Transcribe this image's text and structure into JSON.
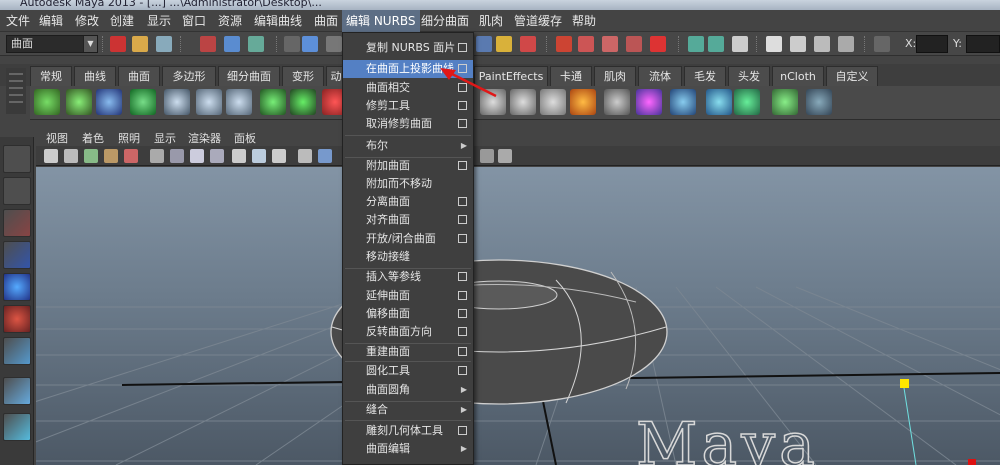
{
  "window_title": "Autodesk Maya 2013 - [...] ...\\Administrator\\Desktop\\...",
  "menubar": {
    "items": [
      "文件",
      "编辑",
      "修改",
      "创建",
      "显示",
      "窗口",
      "资源",
      "编辑曲线",
      "曲面",
      "编辑 NURBS",
      "细分曲面",
      "肌肉",
      "管道缓存",
      "帮助"
    ],
    "active": "编辑 NURBS"
  },
  "statusline": {
    "mode": "曲面",
    "x_label": "X:",
    "y_label": "Y:"
  },
  "shelf": {
    "tabs": [
      "常规",
      "曲线",
      "曲面",
      "多边形",
      "细分曲面",
      "变形",
      "动",
      "PaintEffects",
      "卡通",
      "肌肉",
      "流体",
      "毛发",
      "头发",
      "nCloth",
      "自定义"
    ]
  },
  "panel": {
    "menu": [
      "视图",
      "着色",
      "照明",
      "显示",
      "渲染器",
      "面板"
    ]
  },
  "nurbs_menu": {
    "items": [
      {
        "label": "复制 NURBS 面片",
        "option": true
      },
      {
        "label": "在曲面上投影曲线",
        "option": true,
        "highlighted": true
      },
      {
        "label": "曲面相交",
        "option": true
      },
      {
        "label": "修剪工具",
        "option": true
      },
      {
        "label": "取消修剪曲面",
        "option": true
      },
      {
        "label": "布尔",
        "submenu": true
      },
      {
        "label": "附加曲面",
        "option": true
      },
      {
        "label": "附加而不移动"
      },
      {
        "label": "分离曲面",
        "option": true
      },
      {
        "label": "对齐曲面",
        "option": true
      },
      {
        "label": "开放/闭合曲面",
        "option": true
      },
      {
        "label": "移动接缝"
      },
      {
        "label": "插入等参线",
        "option": true
      },
      {
        "label": "延伸曲面",
        "option": true
      },
      {
        "label": "偏移曲面",
        "option": true
      },
      {
        "label": "反转曲面方向",
        "option": true
      },
      {
        "label": "重建曲面",
        "option": true
      },
      {
        "label": "圆化工具",
        "option": true
      },
      {
        "label": "曲面圆角",
        "submenu": true
      },
      {
        "label": "缝合",
        "submenu": true
      },
      {
        "label": "雕刻几何体工具",
        "option": true
      },
      {
        "label": "曲面编辑",
        "submenu": true
      },
      {
        "label": "..."
      }
    ]
  },
  "watermark": "Maya",
  "colors": {
    "menu_highlight": "#5480c4",
    "active_menu": "#5d6e85",
    "viewport_top": "#8394a5",
    "viewport_bottom": "#4c5865",
    "annotation_arrow": "#e01818"
  }
}
